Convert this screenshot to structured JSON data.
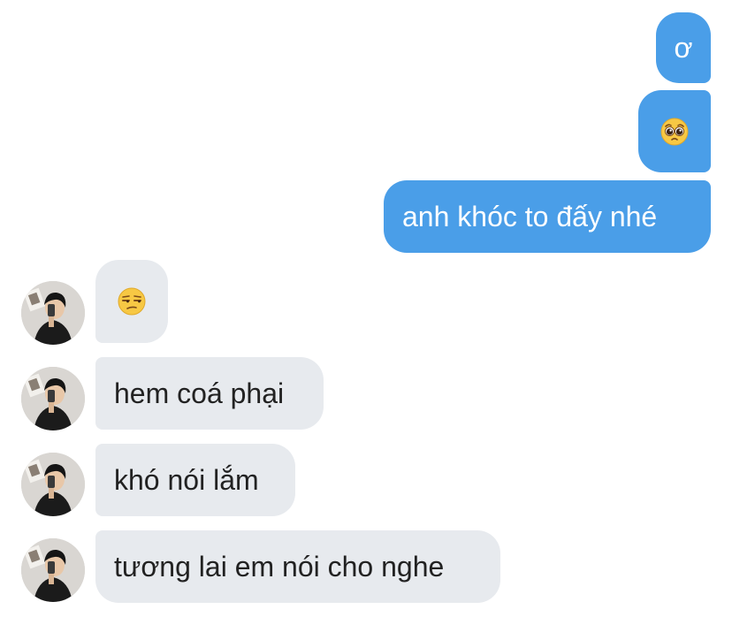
{
  "conversation": {
    "messages": [
      {
        "direction": "outgoing",
        "text": "ơ"
      },
      {
        "direction": "outgoing",
        "icon": "pleading-face-emoji"
      },
      {
        "direction": "outgoing",
        "text": "anh khóc to đấy nhé"
      },
      {
        "direction": "incoming",
        "icon": "unamused-face-emoji"
      },
      {
        "direction": "incoming",
        "text": "hem coá phại"
      },
      {
        "direction": "incoming",
        "text": "khó nói lắm"
      },
      {
        "direction": "incoming",
        "text": "tương lai em nói cho nghe"
      }
    ],
    "colors": {
      "outgoing_bubble": "#4a9ee8",
      "incoming_bubble": "#e7eaee",
      "background": "#ffffff"
    }
  }
}
